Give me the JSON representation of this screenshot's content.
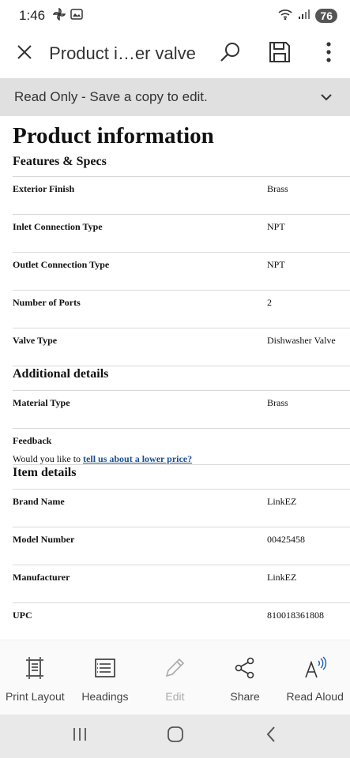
{
  "status": {
    "time": "1:46",
    "battery": "76",
    "icons": [
      "pinwheel-icon",
      "gallery-icon",
      "wifi-icon",
      "signal-icon"
    ]
  },
  "toolbar": {
    "title": "Product i…er valve",
    "icons": [
      "close-icon",
      "search-icon",
      "save-icon",
      "more-icon"
    ]
  },
  "readonly": {
    "text": "Read Only - Save a copy to edit."
  },
  "doc": {
    "title": "Product information",
    "sections": [
      {
        "heading": "Features & Specs",
        "rows": [
          {
            "label": "Exterior Finish",
            "value": "Brass"
          },
          {
            "label": "Inlet Connection Type",
            "value": "NPT"
          },
          {
            "label": "Outlet Connection Type",
            "value": "NPT"
          },
          {
            "label": "Number of Ports",
            "value": "2"
          },
          {
            "label": "Valve Type",
            "value": "Dishwasher Valve"
          }
        ]
      },
      {
        "heading": "Additional details",
        "rows": [
          {
            "label": "Material Type",
            "value": "Brass"
          }
        ]
      },
      {
        "heading": "Item details",
        "rows": [
          {
            "label": "Brand Name",
            "value": "LinkEZ"
          },
          {
            "label": "Model Number",
            "value": "00425458"
          },
          {
            "label": "Manufacturer",
            "value": "LinkEZ"
          },
          {
            "label": "UPC",
            "value": "810018361808"
          }
        ]
      }
    ],
    "feedback": {
      "title": "Feedback",
      "prefix": "Would you like to",
      "link": "tell us about a lower price?"
    }
  },
  "actions": [
    {
      "label": "Print Layout",
      "icon": "print-layout-icon"
    },
    {
      "label": "Headings",
      "icon": "headings-icon"
    },
    {
      "label": "Edit",
      "icon": "pencil-icon"
    },
    {
      "label": "Share",
      "icon": "share-icon"
    },
    {
      "label": "Read Aloud",
      "icon": "read-aloud-icon"
    }
  ]
}
